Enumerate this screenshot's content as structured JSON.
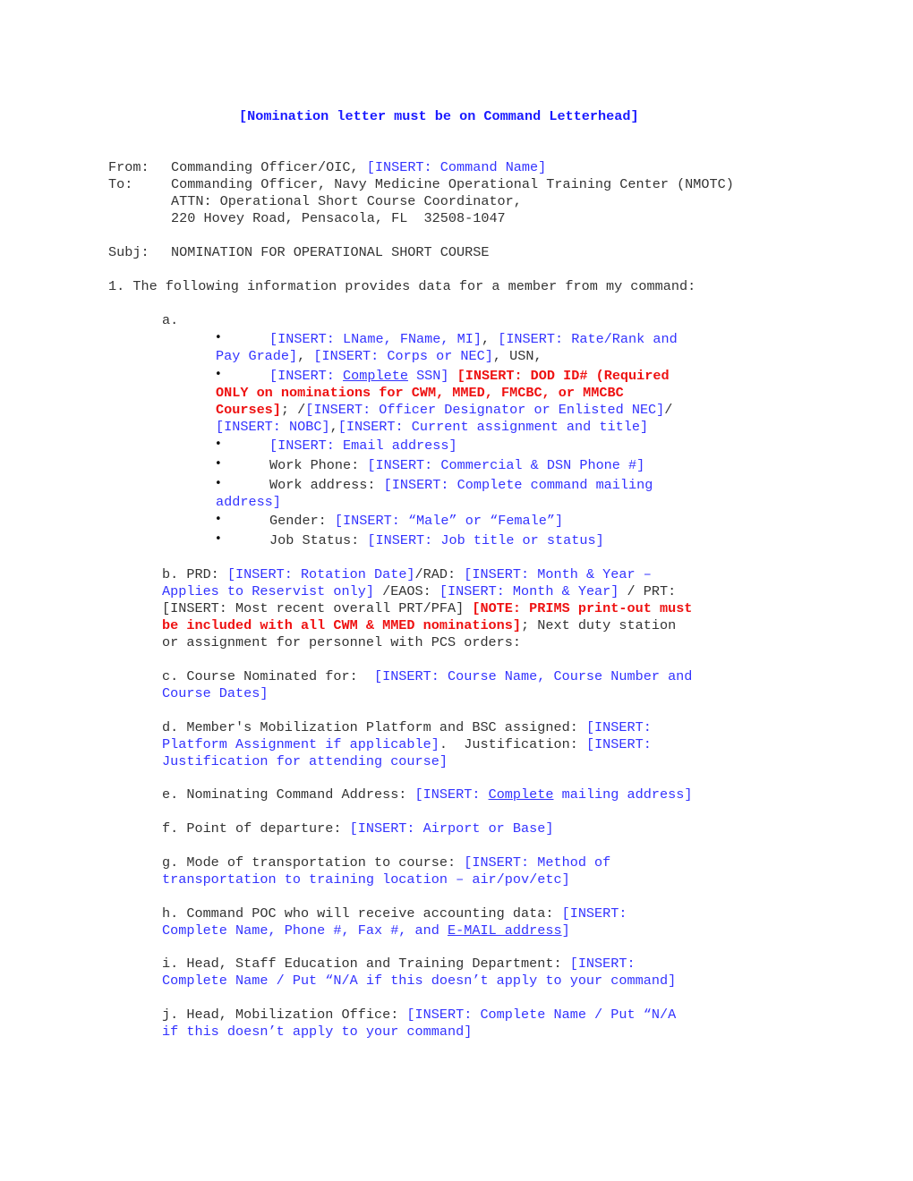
{
  "header_note": "[Nomination letter must be on Command Letterhead]",
  "from": {
    "label": "From:",
    "text": "Commanding Officer/OIC, ",
    "insert": "[INSERT: Command Name]"
  },
  "to": {
    "label": "To:",
    "line1": "Commanding Officer, Navy Medicine Operational Training Center (NMOTC)",
    "line2": "ATTN: Operational Short Course Coordinator,",
    "line3": "220 Hovey Road, Pensacola, FL  32508-1047"
  },
  "subj": {
    "label": "Subj:",
    "text": "NOMINATION FOR OPERATIONAL SHORT COURSE"
  },
  "para1": "1. The following information provides data for a member from my command:",
  "item_a": {
    "label": "a.",
    "b1_l1_p1": "[INSERT: LName, FName, MI]",
    "b1_l1_p2": ", ",
    "b1_l1_p3": "[INSERT: Rate/Rank and",
    "b1_l2_p1": "Pay Grade]",
    "b1_l2_p2": ", ",
    "b1_l2_p3": "[INSERT: Corps or NEC]",
    "b1_l2_p4": ", USN,",
    "b2_l1_p1": "[INSERT: ",
    "b2_l1_p2": "Complete",
    "b2_l1_p3": " SSN]",
    "b2_l1_red": "[INSERT: DOD ID# (Required",
    "b2_l2_red": "ONLY on nominations for CWM, MMED, FMCBC, or MMCBC",
    "b2_l3_red": "Courses]",
    "b2_l3_p1": "; /",
    "b2_l3_p2": "[INSERT: Officer Designator or Enlisted NEC]",
    "b2_l3_p3": "/",
    "b2_l4_p1": "[INSERT: NOBC]",
    "b2_l4_p2": ",",
    "b2_l4_p3": "[INSERT: Current assignment and title]",
    "b3": "[INSERT: Email address]",
    "b4_label": "Work Phone: ",
    "b4_insert": "[INSERT: Commercial & DSN Phone #]",
    "b5_label": "Work address: ",
    "b5_insert1": "[INSERT: Complete command mailing",
    "b5_insert2": "address]",
    "b6_label": "Gender: ",
    "b6_insert": "[INSERT: “Male” or “Female”]",
    "b7_label": "Job Status: ",
    "b7_insert": "[INSERT: Job title or status]"
  },
  "item_b": {
    "l1_p1": "b. PRD: ",
    "l1_p2": "[INSERT: Rotation Date]",
    "l1_p3": "/RAD: ",
    "l1_p4": "[INSERT: Month & Year –",
    "l2_p1": "Applies to Reservist only]",
    "l2_p2": " /EAOS: ",
    "l2_p3": "[INSERT: Month & Year]",
    "l2_p4": " / PRT:",
    "l3_p1": "[INSERT: Most recent overall PRT/PFA] ",
    "l3_red": "[NOTE: PRIMS print-out must",
    "l4_red": "be included with all CWM & MMED nominations]",
    "l4_p1": "; Next duty station",
    "l5": "or assignment for personnel with PCS orders:"
  },
  "item_c": {
    "l1_p1": "c. Course Nominated for:  ",
    "l1_p2": "[INSERT: Course Name, Course Number and",
    "l2": "Course Dates]"
  },
  "item_d": {
    "l1_p1": "d. Member's Mobilization Platform and BSC assigned: ",
    "l1_p2": "[INSERT:",
    "l2_p1": "Platform Assignment if applicable]",
    "l2_p2": ".  Justification: ",
    "l2_p3": "[INSERT:",
    "l3": "Justification for attending course]"
  },
  "item_e": {
    "p1": "e. Nominating Command Address: ",
    "p2": "[INSERT: ",
    "p3": "Complete",
    "p4": " mailing address]"
  },
  "item_f": {
    "p1": "f. Point of departure: ",
    "p2": "[INSERT: Airport or Base]"
  },
  "item_g": {
    "l1_p1": "g. Mode of transportation to course: ",
    "l1_p2": "[INSERT: Method of",
    "l2": "transportation to training location – air/pov/etc]"
  },
  "item_h": {
    "l1_p1": "h. Command POC who will receive accounting data: ",
    "l1_p2": "[INSERT:",
    "l2_p1": "Complete Name, Phone #, Fax #, and ",
    "l2_p2": "E-MAIL address",
    "l2_p3": "]"
  },
  "item_i": {
    "l1_p1": "i. Head, Staff Education and Training Department: ",
    "l1_p2": "[INSERT:",
    "l2": "Complete Name / Put “N/A if this doesn’t apply to your command]"
  },
  "item_j": {
    "l1_p1": "j. Head, Mobilization Office: ",
    "l1_p2": "[INSERT: Complete Name / Put “N/A",
    "l2": "if this doesn’t apply to your command]"
  },
  "bullet_glyph": "•"
}
